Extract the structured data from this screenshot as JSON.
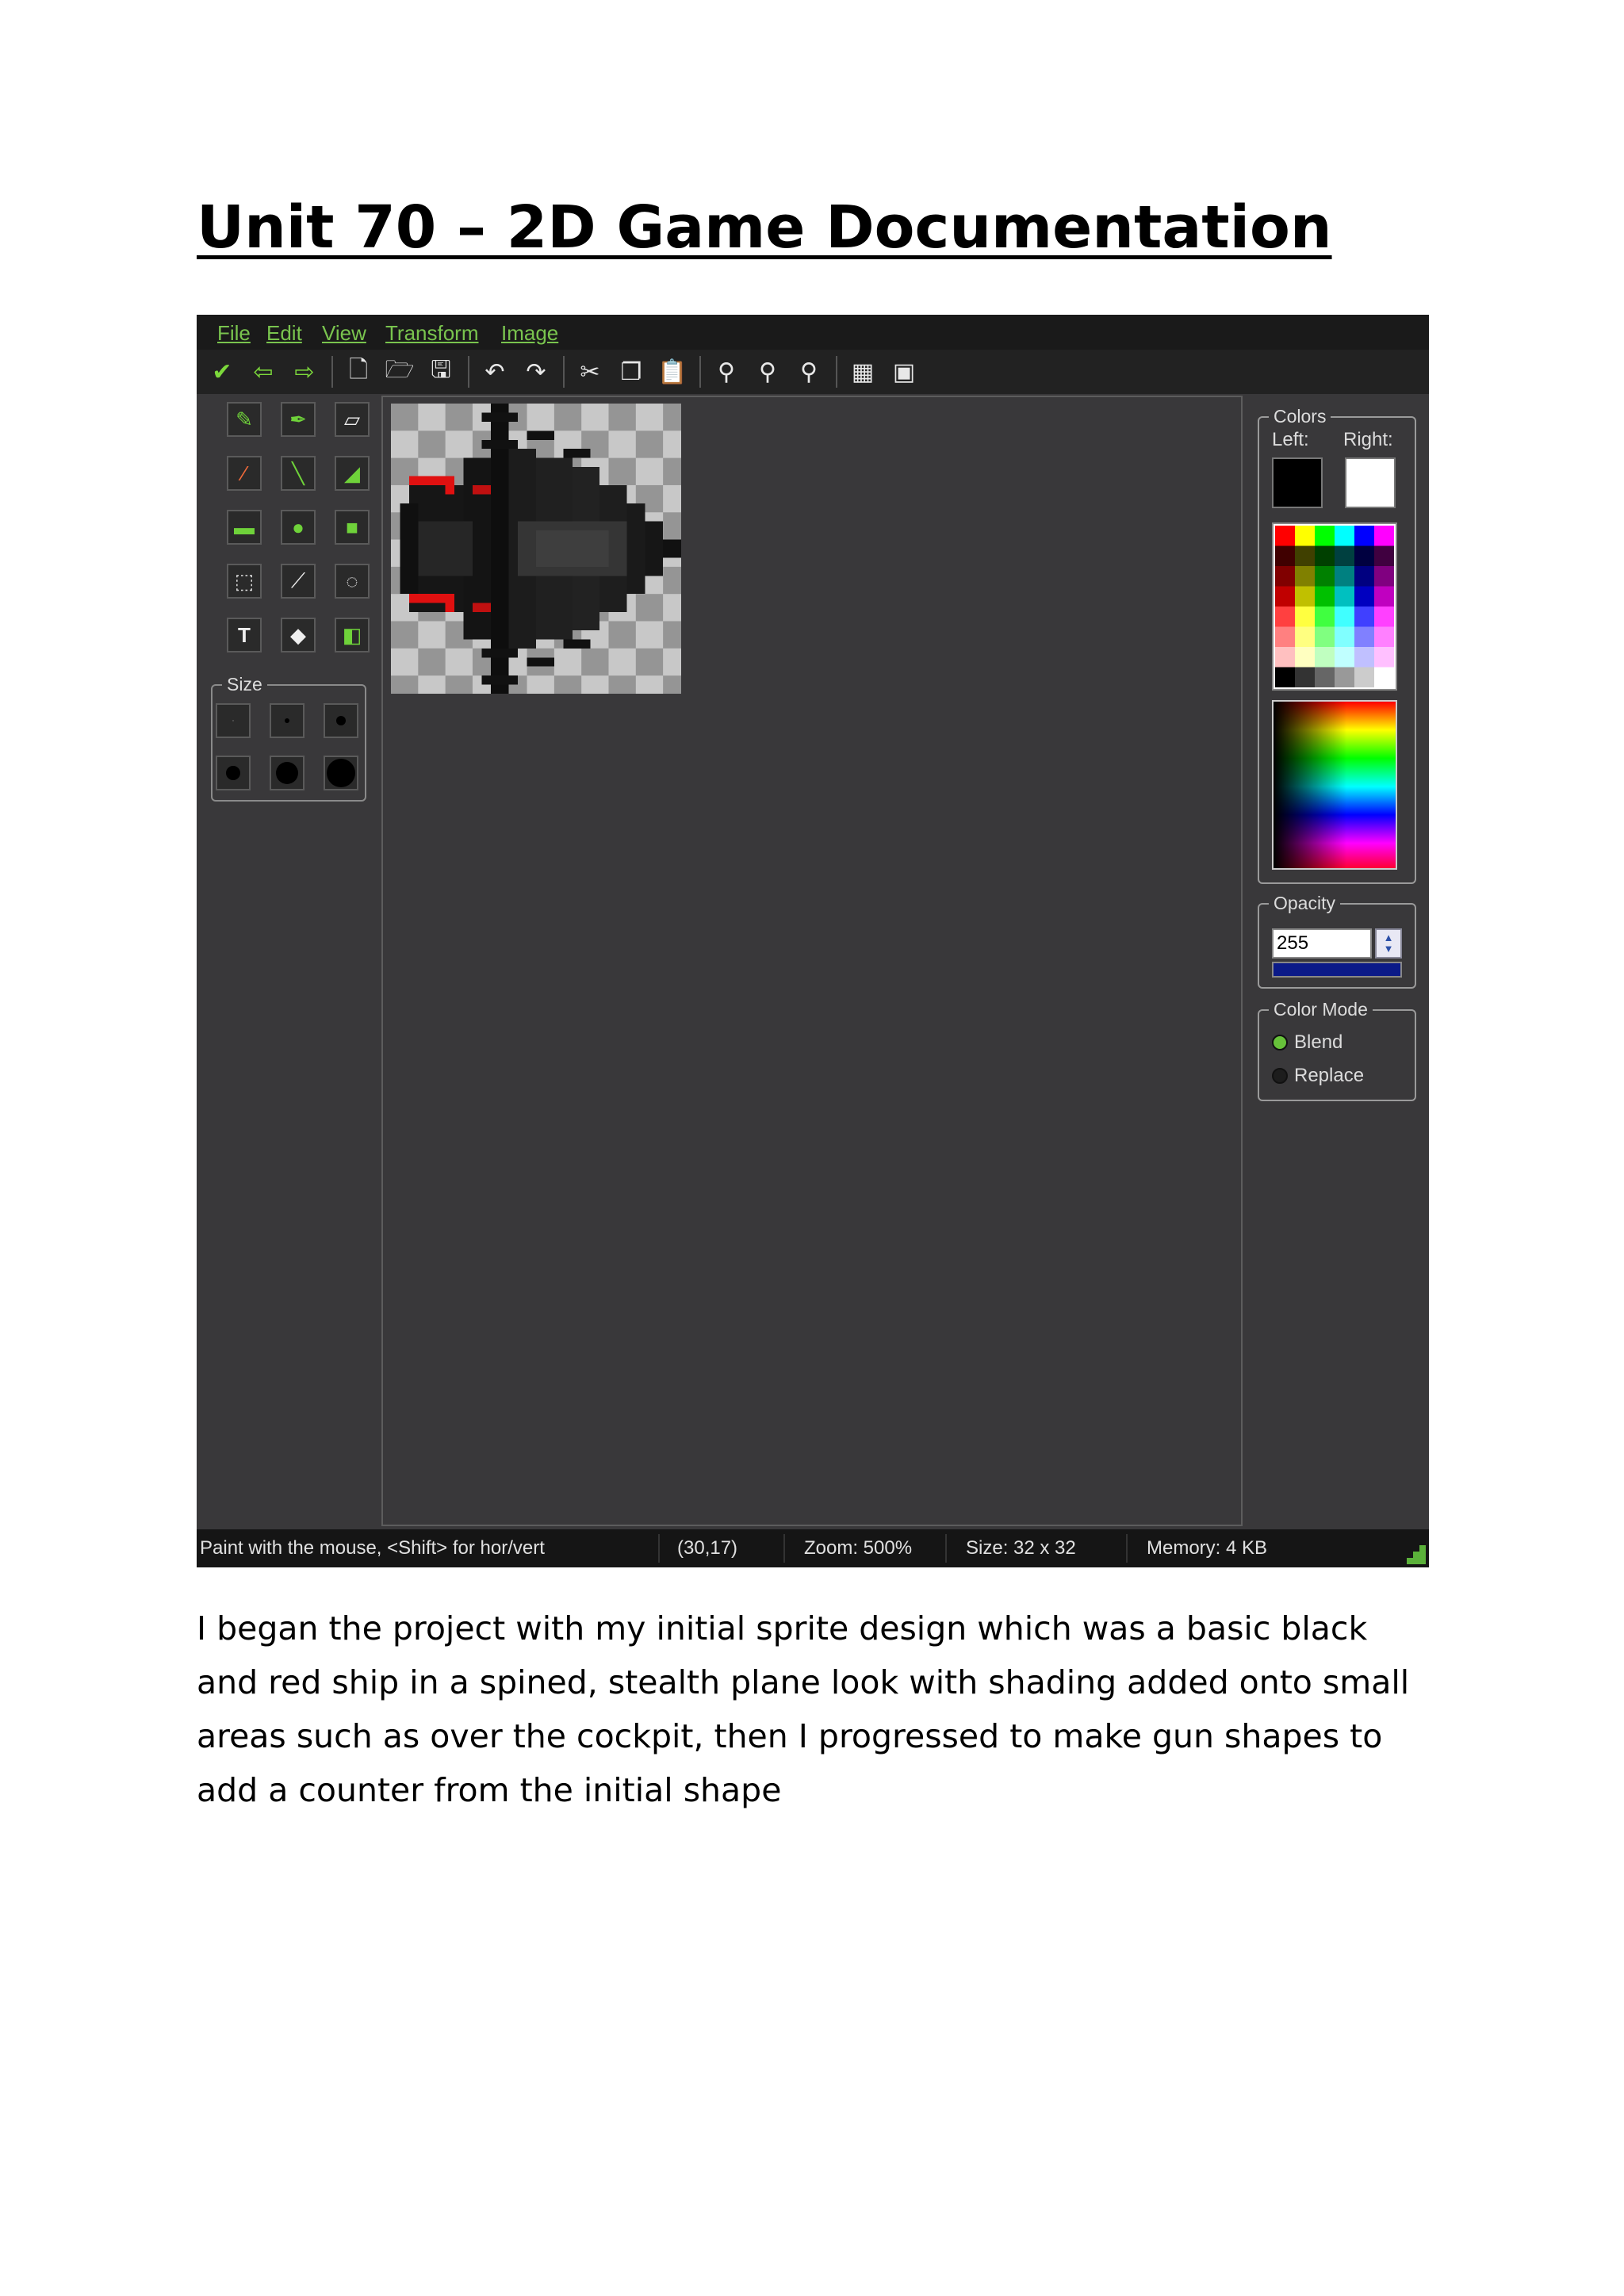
{
  "document": {
    "title": "Unit 70 – 2D Game Documentation",
    "caption": "I began the project with my initial sprite design which was a basic black and red ship in a spined, stealth plane look with shading added onto small areas such as over the cockpit, then I progressed to make gun shapes to add a counter from the initial shape"
  },
  "app": {
    "menu": [
      "File",
      "Edit",
      "View",
      "Transform",
      "Image"
    ],
    "toolbar_icons": [
      "check-icon",
      "back-arrow-icon",
      "forward-arrow-icon",
      "new-file-icon",
      "open-file-icon",
      "save-icon",
      "undo-icon",
      "redo-icon",
      "cut-icon",
      "copy-icon",
      "paste-icon",
      "zoom-in-icon",
      "zoom-out-icon",
      "zoom-reset-icon",
      "grid-icon",
      "image-icon"
    ],
    "tools": [
      "pencil-tool-icon",
      "pen-tool-icon",
      "eraser-tool-icon",
      "brush-tool-icon",
      "line-tool-icon",
      "fill-tool-icon",
      "rectangle-tool-icon",
      "ellipse-tool-icon",
      "rounded-rect-tool-icon",
      "select-rect-tool-icon",
      "color-picker-tool-icon",
      "select-ellipse-tool-icon",
      "text-tool-icon",
      "clear-tool-icon",
      "import-tool-icon"
    ],
    "size_label": "Size",
    "colors": {
      "group_label": "Colors",
      "left_label": "Left:",
      "right_label": "Right:",
      "left_color": "#000000",
      "right_color": "#ffffff"
    },
    "opacity": {
      "label": "Opacity",
      "value": "255"
    },
    "color_mode": {
      "label": "Color Mode",
      "options": [
        "Blend",
        "Replace"
      ],
      "selected": "Blend"
    },
    "status": {
      "hint": "Paint with the mouse, <Shift> for hor/vert",
      "coords": "(30,17)",
      "zoom": "Zoom: 500%",
      "size": "Size: 32 x 32",
      "memory": "Memory: 4 KB"
    },
    "accent_color": "#79c44e"
  }
}
